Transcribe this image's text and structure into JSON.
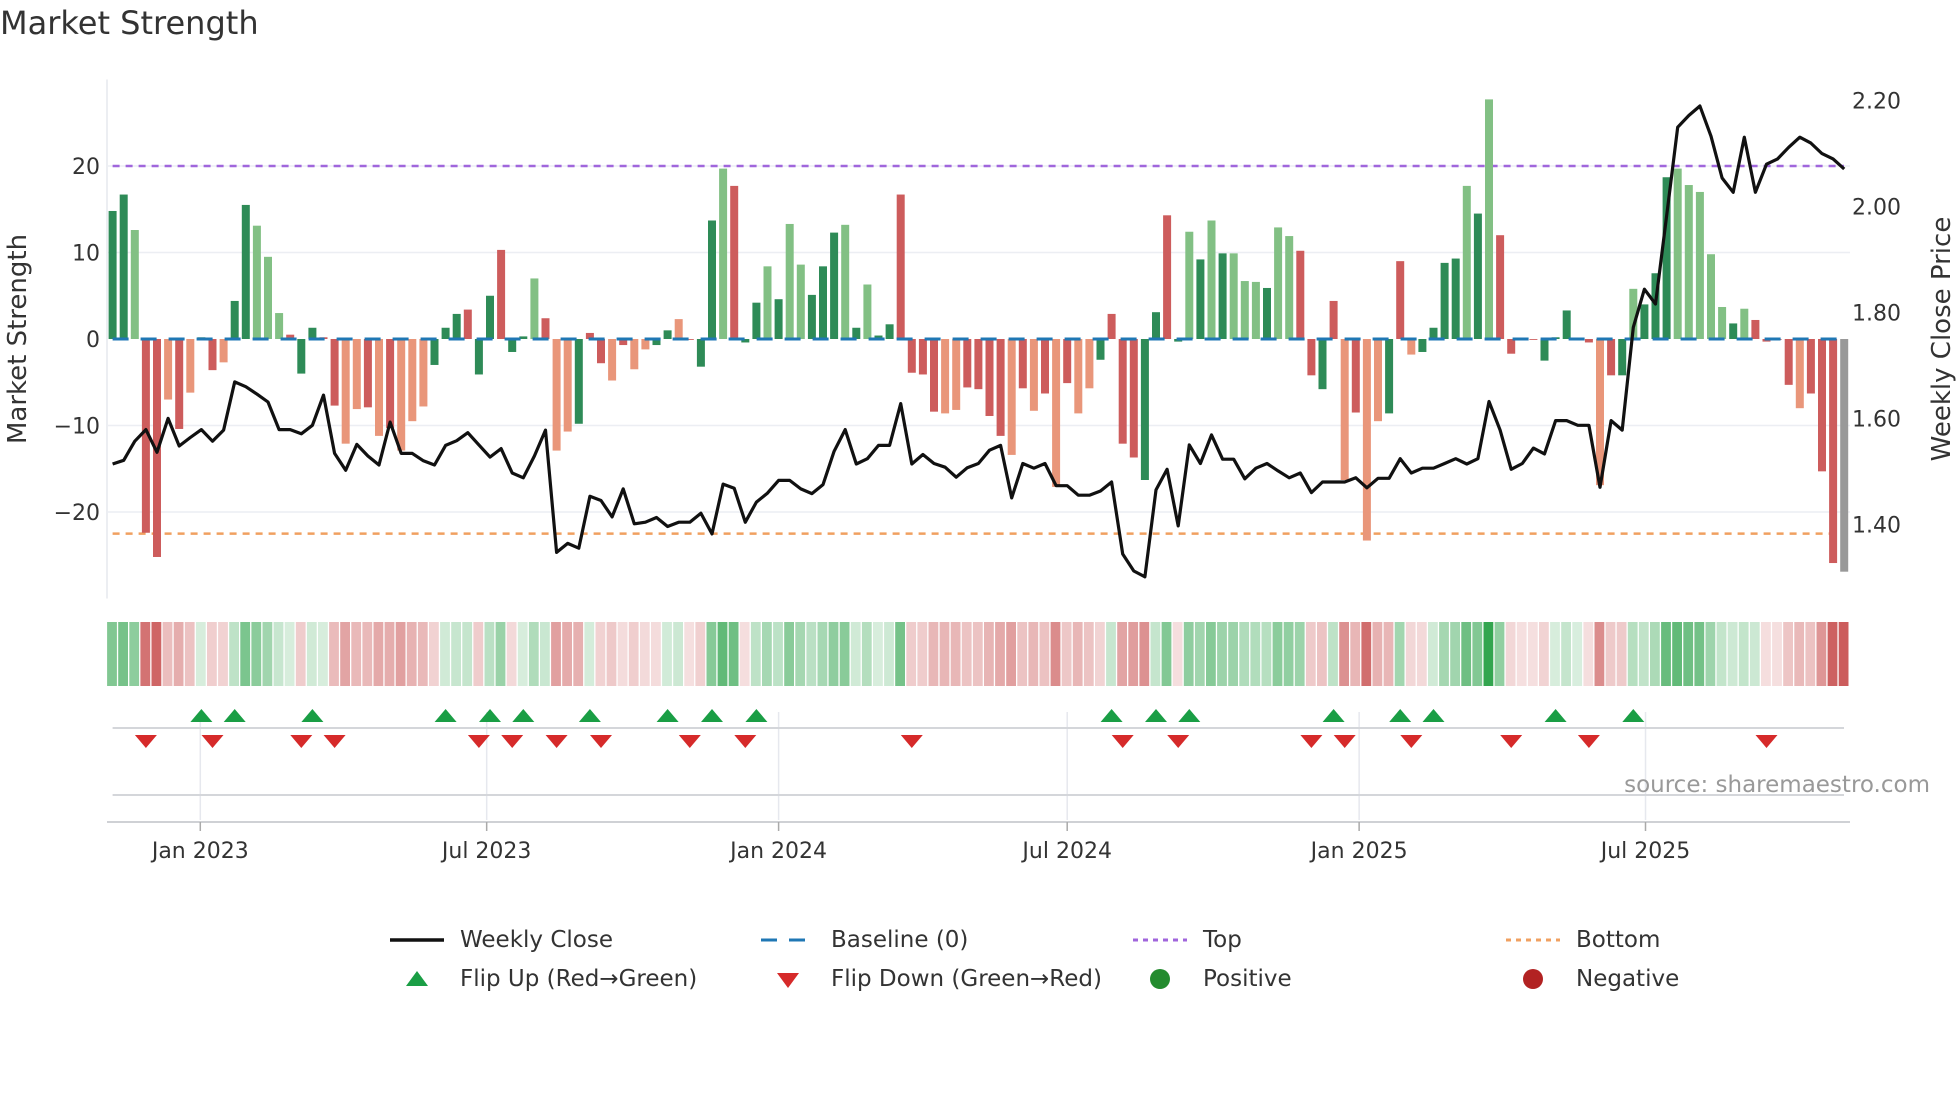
{
  "title": "Market Strength",
  "source_note": "source: sharemaestro.com",
  "legend": [
    {
      "label": "Weekly Close",
      "symbol": "solid-line",
      "color": "#111111"
    },
    {
      "label": "Baseline (0)",
      "symbol": "dashed-line",
      "color": "#1f77b4"
    },
    {
      "label": "Top",
      "symbol": "dotted-line",
      "color": "#a066dc"
    },
    {
      "label": "Bottom",
      "symbol": "dotted-line",
      "color": "#f0a060"
    },
    {
      "label": "Flip Up (Red→Green)",
      "symbol": "triangle-up",
      "color": "#1a9e45"
    },
    {
      "label": "Flip Down (Green→Red)",
      "symbol": "triangle-down",
      "color": "#d62a2a"
    },
    {
      "label": "Positive",
      "symbol": "circle",
      "color": "#238b2e"
    },
    {
      "label": "Negative",
      "symbol": "circle",
      "color": "#b22222"
    }
  ],
  "chart_data": {
    "type": "bar",
    "title": "Market Strength",
    "ylabel": "Market Strength",
    "y2label": "Weekly Close Price",
    "ylim": [
      -30,
      30
    ],
    "y2lim": [
      1.26,
      2.24
    ],
    "yticks": [
      -20,
      -10,
      0,
      10,
      20
    ],
    "yticklabels": [
      "−20",
      "−10",
      "0",
      "10",
      "20"
    ],
    "y2ticks": [
      1.4,
      1.6,
      1.8,
      2.0,
      2.2
    ],
    "y2ticklabels": [
      "1.40",
      "1.60",
      "1.80",
      "2.00",
      "2.20"
    ],
    "x_unit": "week index",
    "xticks": [
      7.9,
      33.7,
      60.0,
      86.0,
      112.3,
      138.1
    ],
    "xticklabels": [
      "Jan 2023",
      "Jul 2023",
      "Jan 2024",
      "Jul 2024",
      "Jan 2025",
      "Jul 2025"
    ],
    "top_level": 20,
    "bottom_level": -22.5,
    "baseline": 0,
    "bar_colors": {
      "G": "#2e8b57",
      "g": "#82c084",
      "R": "#cd5c5c",
      "r": "#e9967a"
    },
    "strength": [
      14.8,
      16.7,
      12.6,
      -22.4,
      -25.2,
      -7.0,
      -10.4,
      -6.2,
      0.2,
      -3.6,
      -2.7,
      4.4,
      15.5,
      13.1,
      9.5,
      3.0,
      0.5,
      -4.0,
      1.3,
      0.2,
      -7.7,
      -12.1,
      -8.1,
      -7.9,
      -11.2,
      -10.3,
      -12.9,
      -9.5,
      -7.8,
      -3.0,
      1.3,
      2.9,
      3.4,
      -4.1,
      5.0,
      10.3,
      -1.5,
      0.3,
      7.0,
      2.4,
      -12.9,
      -10.7,
      -9.8,
      0.7,
      -2.8,
      -4.8,
      -0.7,
      -3.5,
      -1.2,
      -0.7,
      1.0,
      2.3,
      -0.1,
      -3.2,
      13.7,
      19.7,
      17.7,
      -0.4,
      4.2,
      8.4,
      4.6,
      13.3,
      8.6,
      5.1,
      8.4,
      12.3,
      13.2,
      1.3,
      6.3,
      0.4,
      1.7,
      16.7,
      -3.9,
      -4.1,
      -8.4,
      -8.6,
      -8.2,
      -5.6,
      -5.8,
      -8.9,
      -11.2,
      -13.4,
      -5.7,
      -8.3,
      -6.3,
      -17.1,
      -5.1,
      -8.6,
      -5.7,
      -2.4,
      2.9,
      -12.1,
      -13.7,
      -16.3,
      3.1,
      14.3,
      -0.3,
      12.4,
      9.2,
      13.7,
      9.9,
      9.9,
      6.7,
      6.6,
      5.9,
      12.9,
      11.9,
      10.2,
      -4.2,
      -5.8,
      4.4,
      -16.3,
      -8.5,
      -23.3,
      -9.5,
      -8.6,
      9.0,
      -1.8,
      -1.5,
      1.3,
      8.8,
      9.3,
      17.7,
      14.5,
      27.7,
      12.0,
      -1.7,
      -0.1,
      -0.1,
      -2.5,
      0.2,
      3.3,
      0.1,
      -0.4,
      -16.9,
      -4.2,
      -4.2,
      5.8,
      4.0,
      7.6,
      18.7,
      19.7,
      17.8,
      17.0,
      9.8,
      3.7,
      1.8,
      3.5,
      2.2,
      -0.3,
      -0.1,
      -5.3,
      -8.0,
      -6.3,
      -15.3,
      -25.9,
      -26.9
    ],
    "shade": "GGgRRrRrGRrGGgggRGGRRrrRrRrrrGGGRGGRGGgRrrGRRrRrrGGrRGGgRGGgGggGGGgGgGGRRRRrrRRRRrRrRrRrrGRRRGGRGgGgGgggGggRRGRrRrrGRrGGGGgGgRRRRGGGRRrRGgGGGgggggGgRRRRrRRR",
    "weekly_close": [
      1.514,
      1.521,
      1.557,
      1.579,
      1.536,
      1.6,
      1.548,
      1.564,
      1.579,
      1.557,
      1.578,
      1.669,
      1.66,
      1.646,
      1.631,
      1.579,
      1.579,
      1.571,
      1.587,
      1.644,
      1.534,
      1.502,
      1.551,
      1.529,
      1.512,
      1.593,
      1.534,
      1.534,
      1.52,
      1.512,
      1.549,
      1.558,
      1.573,
      1.55,
      1.527,
      1.543,
      1.497,
      1.488,
      1.529,
      1.578,
      1.347,
      1.364,
      1.355,
      1.453,
      1.445,
      1.414,
      1.467,
      1.401,
      1.404,
      1.413,
      1.396,
      1.404,
      1.404,
      1.421,
      1.382,
      1.476,
      1.468,
      1.404,
      1.442,
      1.459,
      1.483,
      1.483,
      1.467,
      1.458,
      1.475,
      1.538,
      1.579,
      1.514,
      1.524,
      1.549,
      1.549,
      1.628,
      1.514,
      1.532,
      1.515,
      1.508,
      1.489,
      1.507,
      1.515,
      1.54,
      1.549,
      1.45,
      1.515,
      1.506,
      1.515,
      1.473,
      1.473,
      1.455,
      1.455,
      1.463,
      1.48,
      1.344,
      1.312,
      1.301,
      1.465,
      1.504,
      1.397,
      1.55,
      1.515,
      1.569,
      1.523,
      1.523,
      1.486,
      1.506,
      1.515,
      1.501,
      1.488,
      1.497,
      1.46,
      1.48,
      1.48,
      1.48,
      1.488,
      1.469,
      1.487,
      1.487,
      1.524,
      1.497,
      1.506,
      1.506,
      1.515,
      1.524,
      1.514,
      1.524,
      1.632,
      1.578,
      1.504,
      1.515,
      1.544,
      1.533,
      1.596,
      1.596,
      1.587,
      1.587,
      1.47,
      1.596,
      1.578,
      1.772,
      1.844,
      1.816,
      1.982,
      2.15,
      2.172,
      2.19,
      2.133,
      2.054,
      2.027,
      2.131,
      2.027,
      2.08,
      2.09,
      2.112,
      2.131,
      2.12,
      2.1,
      2.09,
      2.071
    ],
    "flip_up": [
      8,
      11,
      18,
      30,
      34,
      37,
      43,
      50,
      54,
      58,
      90,
      94,
      97,
      110,
      116,
      119,
      130,
      137
    ],
    "flip_down": [
      3,
      9,
      17,
      20,
      33,
      36,
      40,
      44,
      52,
      57,
      72,
      91,
      96,
      108,
      111,
      117,
      126,
      133,
      149
    ]
  }
}
